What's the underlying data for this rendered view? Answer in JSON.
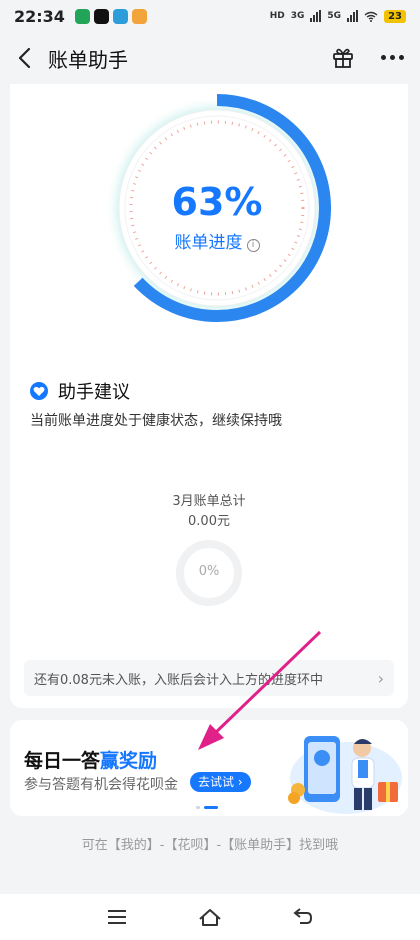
{
  "status_bar": {
    "time": "22:34",
    "network1": "HD",
    "network2": "3G",
    "network3": "5G",
    "battery": "23",
    "icons": [
      "wechat-icon",
      "tiktok-icon",
      "telegram-icon",
      "app-icon"
    ]
  },
  "header": {
    "title": "账单助手",
    "icons": [
      "back-arrow-icon",
      "gift-icon",
      "more-icon"
    ]
  },
  "progress": {
    "percent_text": "63%",
    "value": 0.63,
    "label": "账单进度"
  },
  "advice": {
    "title": "助手建议",
    "text": "当前账单进度处于健康状态，继续保持哦"
  },
  "summary": {
    "label": "3月账单总计",
    "amount": "0.00元",
    "percent_text": "0%"
  },
  "notice": {
    "text": "还有0.08元未入账，入账后会计入上方的进度环中"
  },
  "promo": {
    "title_prefix": "每日一答",
    "title_highlight": "赢奖励",
    "subtitle": "参与答题有机会得花呗金",
    "button": "去试试"
  },
  "footer_hint": "可在【我的】-【花呗】-【账单助手】找到哦",
  "colors": {
    "accent": "#1677ff",
    "annotation": "#e0218a",
    "background": "#f3f4f6"
  }
}
